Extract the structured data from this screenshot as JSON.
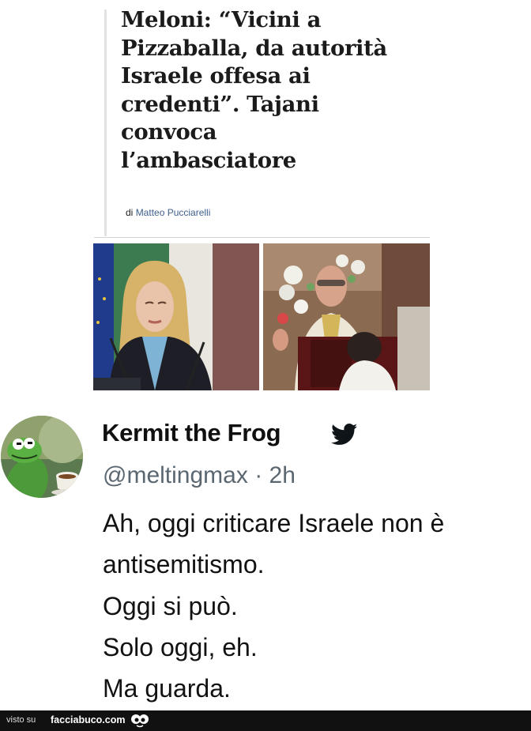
{
  "article": {
    "headline_lines": [
      "Meloni: “Vicini a",
      "Pizzaballa, da autorità",
      "Israele offesa ai",
      "credenti”. Tajani",
      "convoca",
      "l’ambasciatore"
    ],
    "byline_prefix": "di",
    "byline_author": "Matteo Pucciarelli"
  },
  "tweet": {
    "display_name": "Kermit the Frog",
    "handle": "@meltingmax",
    "separator": "·",
    "time": "2h",
    "lines": [
      "Ah, oggi criticare Israele non è",
      "antisemitismo.",
      "Oggi si può.",
      "Solo oggi, eh.",
      "Ma guarda."
    ],
    "icons": {
      "verified": "twitter-bird-icon",
      "avatar": "kermit-avatar"
    }
  },
  "footer": {
    "visto_su": "visto su",
    "site": "facciabuco.com",
    "logo_icon": "facciabuco-eyes-icon"
  },
  "colors": {
    "byline_author": "#3f5f8e",
    "twitter_blue": "#1d9bf0",
    "handle_gray": "#5b6770",
    "footer_bg": "#111111"
  }
}
